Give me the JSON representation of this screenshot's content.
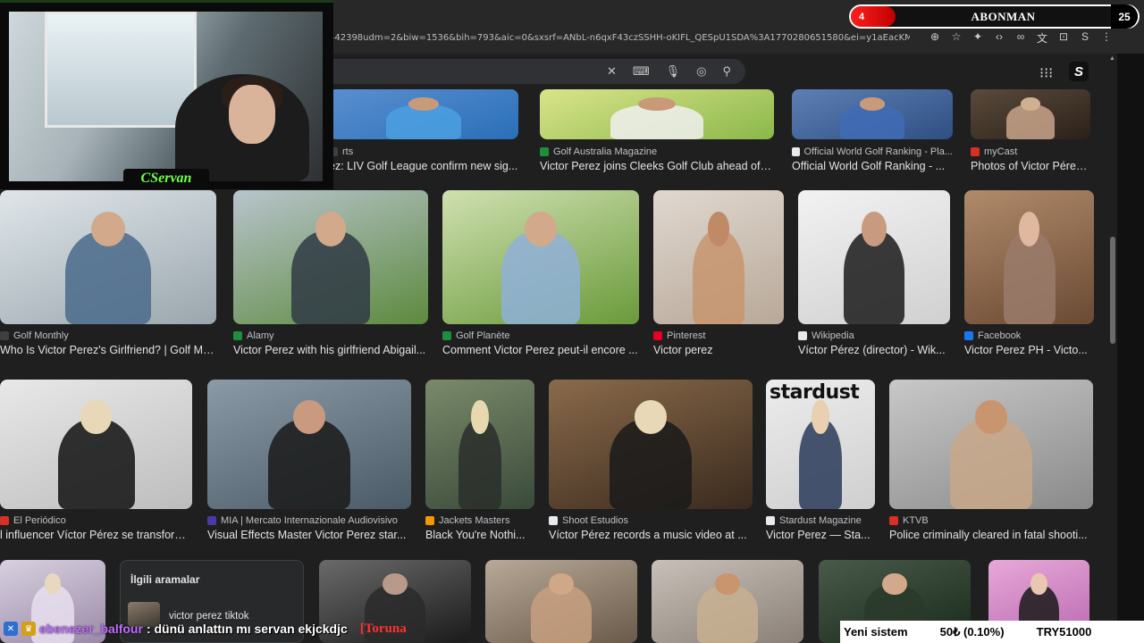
{
  "browser": {
    "url": "442398udm=2&biw=1536&bih=793&aic=0&sxsrf=ANbL-n6qxF43czSSHH-oKIFL_QESpU1SDA%3A1770280651580&ei=y1aEacKMI6qEwPAP9Mjh4Qc&ve...",
    "window_controls": [
      "—",
      "☐",
      "✕"
    ]
  },
  "abonman": {
    "count_left": "4",
    "label": "ABONMAN",
    "count_right": "25"
  },
  "search": {
    "icons": [
      "clear-icon",
      "keyboard-icon",
      "mic-icon",
      "lens-icon",
      "search-icon"
    ]
  },
  "rows": [
    {
      "cards": [
        {
          "source": "rts",
          "title": "ez: LIV Golf League confirm new sig...",
          "fav": "#3c4043",
          "c1": "#5a8fd0",
          "c2": "#2a6fb8",
          "c3": "#4aa0e0",
          "c4": "#c99a7a"
        },
        {
          "source": "Golf Australia Magazine",
          "title": "Victor Perez joins Cleeks Golf Club ahead of 2...",
          "fav": "#1e8e3e",
          "c1": "#d9e48a",
          "c2": "#8bb84a",
          "c3": "#f0f0f0",
          "c4": "#c99a7a"
        },
        {
          "source": "Official World Golf Ranking - Pla...",
          "title": "Official World Golf Ranking - ...",
          "fav": "#e8eaed",
          "c1": "#5d7fb5",
          "c2": "#2f4f82",
          "c3": "#3f6bb5",
          "c4": "#c99a7a"
        },
        {
          "source": "myCast",
          "title": "Photos of Victor Pérez...",
          "fav": "#d93025",
          "c1": "#5a4a3a",
          "c2": "#2b211a",
          "c3": "#c8a58a",
          "c4": "#d0b090"
        }
      ]
    },
    {
      "cards": [
        {
          "source": "Golf Monthly",
          "title": "Who Is Victor Perez's Girlfriend? | Golf Mont...",
          "fav": "#3c4043",
          "c1": "#dfe6ea",
          "c2": "#9aa6ad",
          "c3": "#4a6a8a",
          "c4": "#d2a98a"
        },
        {
          "source": "Alamy",
          "title": "Victor Perez with his girlfriend Abigail...",
          "fav": "#1e8e3e",
          "c1": "#b8c4cc",
          "c2": "#5d8a3f",
          "c3": "#2f3a44",
          "c4": "#d2a98a"
        },
        {
          "source": "Golf Planète",
          "title": "Comment Victor Perez peut-il encore ...",
          "fav": "#1e8e3e",
          "c1": "#cfe0b0",
          "c2": "#6a9a3a",
          "c3": "#8fb0d8",
          "c4": "#d2a98a"
        },
        {
          "source": "Pinterest",
          "title": "Victor perez",
          "fav": "#e60023",
          "c1": "#e0d8d0",
          "c2": "#b8a898",
          "c3": "#c8956e",
          "c4": "#c08a66"
        },
        {
          "source": "Wikipedia",
          "title": "Víctor Pérez (director) - Wik...",
          "fav": "#e8eaed",
          "c1": "#f2f2f2",
          "c2": "#d0d0d0",
          "c3": "#1a1a1a",
          "c4": "#c99a80"
        },
        {
          "source": "Facebook",
          "title": "Victor Perez PH - Victo...",
          "fav": "#1877f2",
          "c1": "#b08a6a",
          "c2": "#6a4a34",
          "c3": "#9a7a6a",
          "c4": "#e0b8a0"
        }
      ]
    },
    {
      "cards": [
        {
          "source": "El Periódico",
          "title": "l influencer Víctor Pérez se transform...",
          "fav": "#d93025",
          "c1": "#e8e8e8",
          "c2": "#bdbdbd",
          "c3": "#111111",
          "c4": "#e8d8b8"
        },
        {
          "source": "MIA | Mercato Internazionale Audiovisivo",
          "title": "Visual Effects Master Victor Perez star...",
          "fav": "#4a3aa8",
          "c1": "#8a9aa6",
          "c2": "#4a5a66",
          "c3": "#1a1a1a",
          "c4": "#c99a80"
        },
        {
          "source": "Jackets Masters",
          "title": "Black You're Nothi...",
          "fav": "#f29900",
          "c1": "#7a8a6a",
          "c2": "#3a4a3a",
          "c3": "#2a2e2a",
          "c4": "#e8d8b0"
        },
        {
          "source": "Shoot Estudios",
          "title": "Víctor Pérez records a music video at ...",
          "fav": "#e8eaed",
          "c1": "#8a6a4a",
          "c2": "#3a2a1e",
          "c3": "#1a1a1a",
          "c4": "#e8d8b8"
        },
        {
          "source": "Stardust Magazine",
          "title": "Victor Perez — Sta...",
          "fav": "#e8eaed",
          "c1": "#ececec",
          "c2": "#cfcfcf",
          "c3": "#2a3a5a",
          "c4": "#e8d0b0",
          "overlay": "stardust"
        },
        {
          "source": "KTVB",
          "title": "Police criminally cleared in fatal shooti...",
          "fav": "#d93025",
          "c1": "#c8c8c8",
          "c2": "#8a8a8a",
          "c3": "#c8a888",
          "c4": "#c8956e"
        }
      ]
    },
    {
      "cards": [
        {
          "c1": "#d8d0e0",
          "c2": "#9a8aa8",
          "c3": "#e8e0f0",
          "c4": "#e8d8c0"
        },
        {
          "c1": "#6a6a6a",
          "c2": "#1a1a1a",
          "c3": "#2a2a2a",
          "c4": "#b89a8a"
        },
        {
          "c1": "#b8a898",
          "c2": "#6a5a4a",
          "c3": "#c8a080",
          "c4": "#d0a888"
        },
        {
          "c1": "#c8c0b8",
          "c2": "#8a8078",
          "c3": "#c8b090",
          "c4": "#c8956e"
        },
        {
          "c1": "#4a5a4a",
          "c2": "#1a2a1a",
          "c3": "#2a3a2a",
          "c4": "#d2a98a"
        },
        {
          "c1": "#e8a8d8",
          "c2": "#b868b0",
          "c3": "#1a1a1a",
          "c4": "#e8c8b0"
        }
      ]
    }
  ],
  "stardust": {
    "word": "stardust"
  },
  "related": {
    "title": "İlgili aramalar",
    "item": "victor perez tiktok"
  },
  "webcam": {
    "name": "CServan"
  },
  "chat": {
    "user": "ebenezer_balfour",
    "message": ": dünü anlattın mı servan ekjckdjc",
    "tag": "[Toruna"
  },
  "ticker": {
    "text": "Yeni sistem          50₺ (0.10%)          TRY51000"
  }
}
